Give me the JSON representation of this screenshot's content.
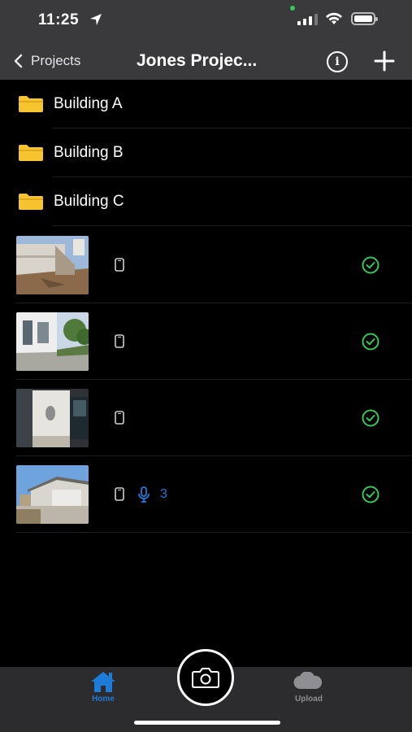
{
  "status_bar": {
    "time": "11:25"
  },
  "navbar": {
    "back_label": "Projects",
    "title": "Jones Projec..."
  },
  "folders": [
    {
      "name": "Building A",
      "icon": "folder-icon"
    },
    {
      "name": "Building B",
      "icon": "folder-icon"
    },
    {
      "name": "Building C",
      "icon": "folder-icon"
    }
  ],
  "photos": [
    {
      "source_icon": "phone-icon",
      "status_icon": "check-circle-icon",
      "voice_notes": ""
    },
    {
      "source_icon": "phone-icon",
      "status_icon": "check-circle-icon",
      "voice_notes": ""
    },
    {
      "source_icon": "phone-icon",
      "status_icon": "check-circle-icon",
      "voice_notes": ""
    },
    {
      "source_icon": "phone-icon",
      "status_icon": "check-circle-icon",
      "voice_notes": "3"
    }
  ],
  "tabbar": {
    "home_label": "Home",
    "upload_label": "Upload",
    "active_tab": "home"
  },
  "colors": {
    "accent_blue": "#1e7bd8",
    "success_green": "#34c759",
    "folder_yellow": "#f6c42e",
    "bar_gray": "#3a3a3c"
  }
}
